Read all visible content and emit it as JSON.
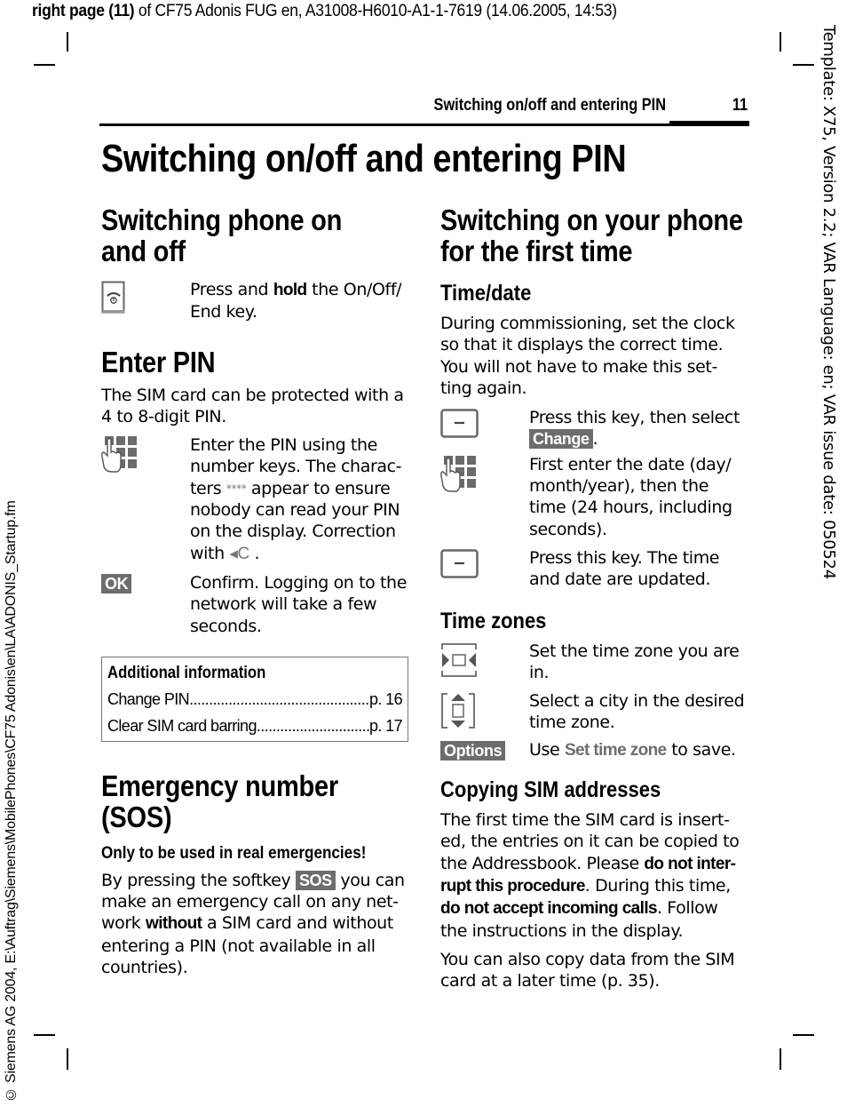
{
  "print_header": {
    "bold_part": "right page (11)",
    "rest": " of CF75 Adonis FUG en, A31008-H6010-A1-1-7619 (14.06.2005, 14:53)"
  },
  "side_right_text": "Template: X75, Version 2.2; VAR Language: en; VAR issue date: 050524",
  "side_left_text": "© Siemens AG 2004, E:\\Auftrag\\Siemens\\MobilePhones\\CF75 Adonis\\en\\LA\\ADONIS_Startup.fm",
  "running_head": {
    "title": "Switching on/off and entering PIN",
    "page_number": "11"
  },
  "page_title": "Switching on/off and entering PIN",
  "left_column": {
    "switching": {
      "heading": "Switching phone on and off",
      "step": {
        "icon": "on-off-end-key-icon",
        "text_before": "Press and ",
        "text_bold": "hold",
        "text_after": " the On/Off/ End key."
      }
    },
    "enter_pin": {
      "heading": "Enter PIN",
      "intro": "The SIM card can be protected with a 4 to 8-digit PIN.",
      "steps": [
        {
          "icon": "keypad-icon",
          "text_a": "Enter the PIN using the number keys. The charac- ters ",
          "mask": "****",
          "text_b": " appear to ensure nobody can read your PIN on the display. Correction with ",
          "clear_key": "◂C",
          "text_c": " ."
        },
        {
          "icon": "ok-softkey",
          "softkey": "OK",
          "text": "Confirm. Logging on to the network will take a few seconds."
        }
      ]
    },
    "additional_info": {
      "heading": "Additional information",
      "rows": [
        {
          "label": "Change PIN",
          "page": "p. 16"
        },
        {
          "label": "Clear SIM card barring ",
          "page": "p. 17"
        }
      ]
    },
    "emergency": {
      "heading": "Emergency number (SOS)",
      "warning": "Only to be used in real emergencies!",
      "text_a": "By pressing the softkey ",
      "softkey": "SOS",
      "text_b": " you can make an emergency call on any net- work ",
      "text_bold": "without",
      "text_c": " a SIM card and without entering a PIN (not available in all countries)."
    }
  },
  "right_column": {
    "heading": "Switching on your phone for the first time",
    "time_date": {
      "heading": "Time/date",
      "intro": "During commissioning, set the clock so that it displays the correct time. You will not have to make this set- ting again.",
      "steps": [
        {
          "icon": "softkey-button-icon",
          "text": "Press this key, then select ",
          "softkey": "Change",
          "text_after": "."
        },
        {
          "icon": "keypad-icon",
          "text": "First enter the date (day/ month/year), then the time (24 hours, including seconds)."
        },
        {
          "icon": "softkey-button-icon",
          "text": "Press this key. The time and date are updated."
        }
      ]
    },
    "time_zones": {
      "heading": "Time zones",
      "steps": [
        {
          "icon": "nav-left-right-icon",
          "text": "Set the time zone you are in."
        },
        {
          "icon": "nav-up-down-icon",
          "text": "Select a city in the desired time zone."
        },
        {
          "icon": "options-softkey",
          "softkey": "Options",
          "text_a": "Use ",
          "menu_item": "Set time zone",
          "text_b": " to save."
        }
      ]
    },
    "copying": {
      "heading": "Copying SIM addresses",
      "p1_a": "The first time the SIM card is insert- ed, the entries on it can be copied to the Addressbook. Please ",
      "p1_bold1": "do not inter- rupt this procedure",
      "p1_b": ". During this time, ",
      "p1_bold2": "do not accept incoming calls",
      "p1_c": ". Follow the instructions in the display.",
      "p2": "You can also copy data from the SIM card at a later time (p. 35)."
    }
  }
}
